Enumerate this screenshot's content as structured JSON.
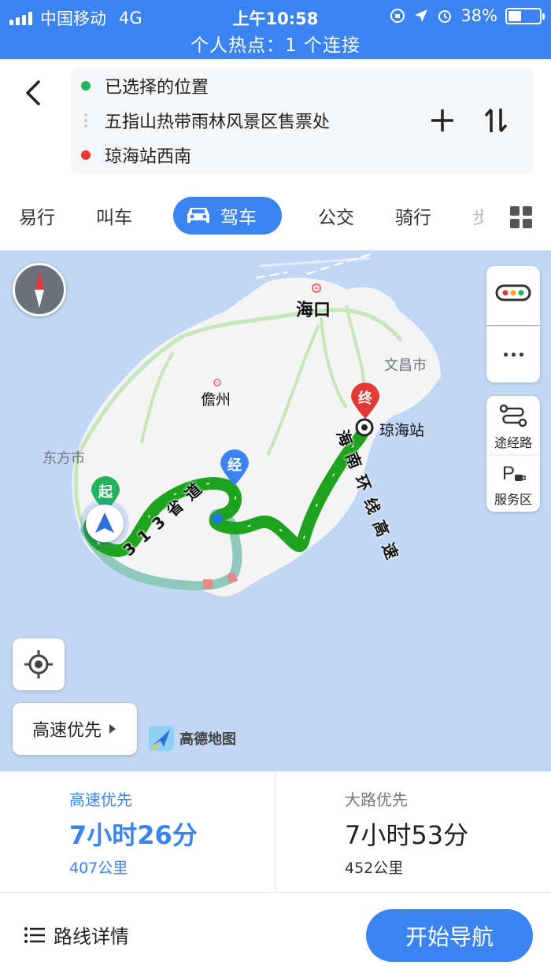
{
  "status_bar": {
    "carrier": "中国移动",
    "network": "4G",
    "time": "上午10:58",
    "battery": "38%",
    "battery_level": 0.38,
    "hotspot": "个人热点：1 个连接"
  },
  "route": {
    "origin": "已选择的位置",
    "via": "五指山热带雨林风景区售票处",
    "destination": "琼海站西南"
  },
  "modes": [
    "易行",
    "叫车",
    "驾车",
    "公交",
    "骑行",
    "步"
  ],
  "active_mode": "驾车",
  "map": {
    "labels": {
      "haikou": "海口",
      "wenchang": "文昌市",
      "danzhou": "儋州",
      "dongfang": "东方市",
      "qionghai_station": "琼海站"
    },
    "road_labels": {
      "s313": "3 1 3 省 道",
      "ring": "海 南 环 线 高 速"
    },
    "pins": {
      "start": "起",
      "via": "经",
      "end": "终"
    },
    "side_buttons": {
      "waypoint": "途经路",
      "service": "服务区"
    },
    "preference_button": "高速优先",
    "logo": "高德地图"
  },
  "routes": [
    {
      "tag": "高速优先",
      "duration": "7小时26分",
      "distance": "407公里"
    },
    {
      "tag": "大路优先",
      "duration": "7小时53分",
      "distance": "452公里"
    }
  ],
  "footer": {
    "details": "路线详情",
    "start": "开始导航"
  },
  "colors": {
    "accent": "#3b83f0",
    "route_green": "#1ea31e",
    "start_pin": "#22b35b",
    "end_pin": "#e53935"
  }
}
